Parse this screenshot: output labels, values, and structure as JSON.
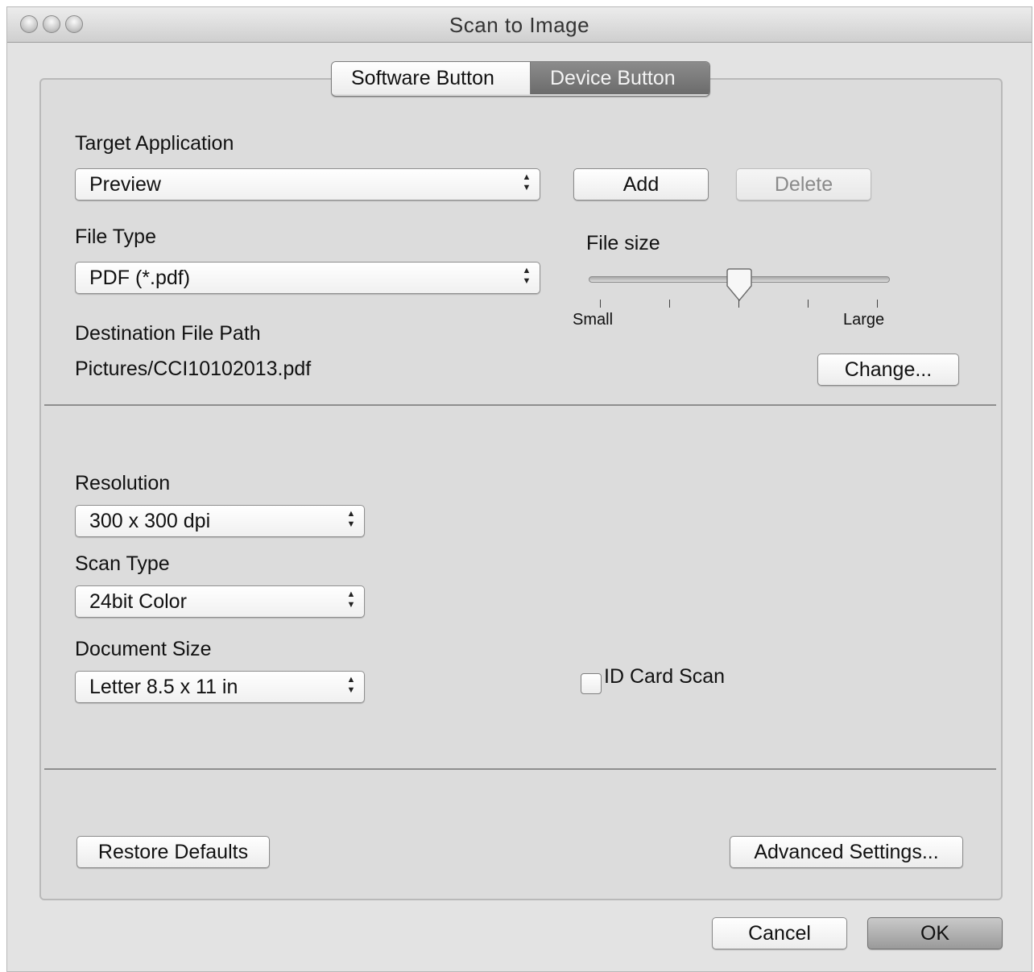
{
  "window": {
    "title": "Scan to Image"
  },
  "tabs": [
    {
      "label": "Software Button",
      "active": false
    },
    {
      "label": "Device Button",
      "active": true
    }
  ],
  "target_application": {
    "label": "Target Application",
    "value": "Preview",
    "add_label": "Add",
    "delete_label": "Delete"
  },
  "file_type": {
    "label": "File Type",
    "value": "PDF (*.pdf)"
  },
  "file_size": {
    "label": "File size",
    "min_label": "Small",
    "max_label": "Large",
    "level_fraction": 0.5
  },
  "destination": {
    "label": "Destination File Path",
    "value": "Pictures/CCI10102013.pdf",
    "change_label": "Change..."
  },
  "resolution": {
    "label": "Resolution",
    "value": "300 x 300 dpi"
  },
  "scan_type": {
    "label": "Scan Type",
    "value": "24bit Color"
  },
  "document_size": {
    "label": "Document Size",
    "value": "Letter 8.5 x 11 in"
  },
  "id_card_scan": {
    "label": "ID Card Scan",
    "checked": false
  },
  "footer": {
    "restore_label": "Restore Defaults",
    "advanced_label": "Advanced Settings...",
    "cancel_label": "Cancel",
    "ok_label": "OK"
  }
}
